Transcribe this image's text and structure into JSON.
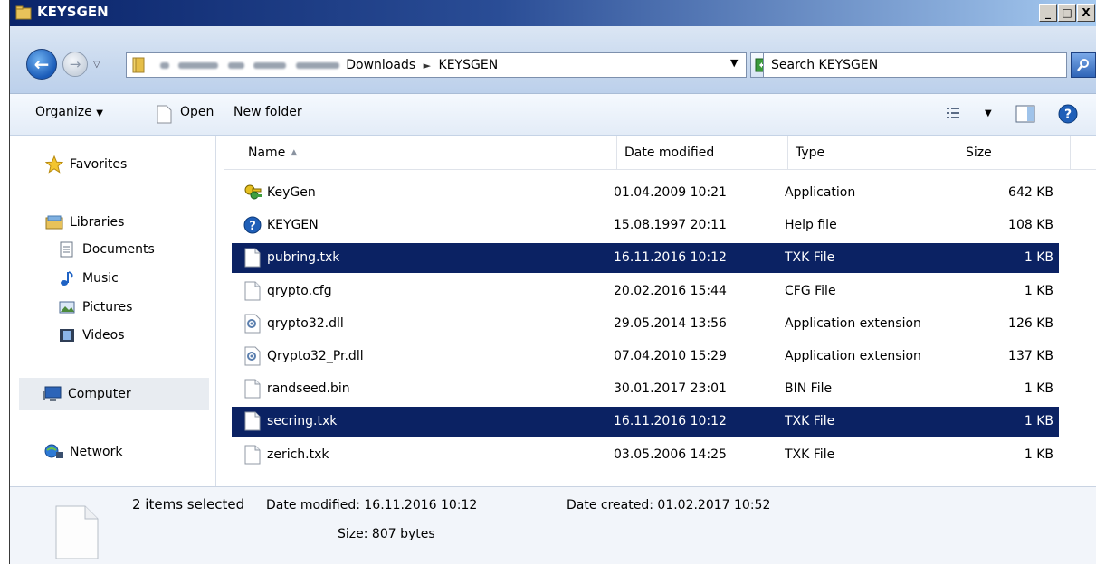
{
  "window": {
    "title": "KEYSGEN",
    "min_label": "_",
    "max_label": "□",
    "close_label": "X"
  },
  "address": {
    "crumb_downloads": "Downloads",
    "crumb_current": "KEYSGEN",
    "search_placeholder": "Search KEYSGEN"
  },
  "toolbar": {
    "organize": "Organize",
    "open": "Open",
    "new_folder": "New folder"
  },
  "nav": {
    "favorites": "Favorites",
    "libraries": "Libraries",
    "documents": "Documents",
    "music": "Music",
    "pictures": "Pictures",
    "videos": "Videos",
    "computer": "Computer",
    "network": "Network"
  },
  "columns": {
    "name": "Name",
    "date": "Date modified",
    "type": "Type",
    "size": "Size"
  },
  "files": [
    {
      "name": "KeyGen",
      "date": "01.04.2009 10:21",
      "type": "Application",
      "size": "642 KB",
      "icon": "keys-icon",
      "selected": false
    },
    {
      "name": "KEYGEN",
      "date": "15.08.1997 20:11",
      "type": "Help file",
      "size": "108 KB",
      "icon": "help-icon",
      "selected": false
    },
    {
      "name": "pubring.txk",
      "date": "16.11.2016 10:12",
      "type": "TXK File",
      "size": "1 KB",
      "icon": "file-icon",
      "selected": true
    },
    {
      "name": "qrypto.cfg",
      "date": "20.02.2016 15:44",
      "type": "CFG File",
      "size": "1 KB",
      "icon": "file-icon",
      "selected": false
    },
    {
      "name": "qrypto32.dll",
      "date": "29.05.2014 13:56",
      "type": "Application extension",
      "size": "126 KB",
      "icon": "dll-icon",
      "selected": false
    },
    {
      "name": "Qrypto32_Pr.dll",
      "date": "07.04.2010 15:29",
      "type": "Application extension",
      "size": "137 KB",
      "icon": "dll-icon",
      "selected": false
    },
    {
      "name": "randseed.bin",
      "date": "30.01.2017 23:01",
      "type": "BIN File",
      "size": "1 KB",
      "icon": "file-icon",
      "selected": false
    },
    {
      "name": "secring.txk",
      "date": "16.11.2016 10:12",
      "type": "TXK File",
      "size": "1 KB",
      "icon": "file-icon",
      "selected": true
    },
    {
      "name": "zerich.txk",
      "date": "03.05.2006 14:25",
      "type": "TXK File",
      "size": "1 KB",
      "icon": "file-icon",
      "selected": false
    }
  ],
  "details": {
    "selection": "2 items selected",
    "date_modified": "Date modified: 16.11.2016 10:12",
    "date_created": "Date created: 01.02.2017 10:52",
    "size": "Size: 807 bytes"
  },
  "colors": {
    "selection_bg": "#0b2263",
    "titlebar_start": "#0a246a",
    "titlebar_end": "#a6caf0"
  }
}
